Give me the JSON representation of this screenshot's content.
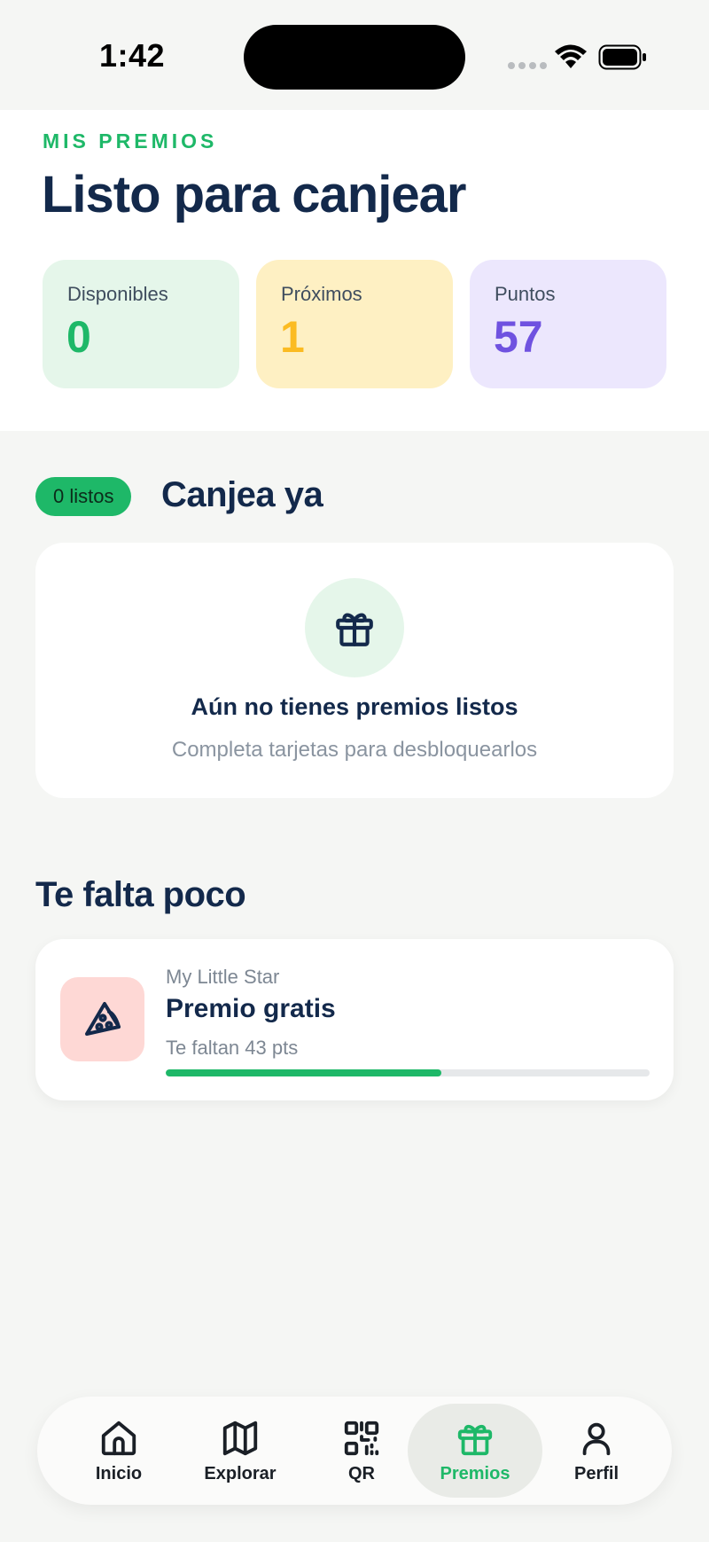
{
  "status_bar": {
    "time": "1:42"
  },
  "header": {
    "eyebrow": "MIS PREMIOS",
    "title": "Listo para canjear",
    "stats": [
      {
        "label": "Disponibles",
        "value": "0",
        "color": "#1eb868"
      },
      {
        "label": "Próximos",
        "value": "1",
        "color": "#fbbb22"
      },
      {
        "label": "Puntos",
        "value": "57",
        "color": "#6f52e0"
      }
    ]
  },
  "ready_section": {
    "badge": "0 listos",
    "title": "Canjea ya",
    "empty_icon": "gift-icon",
    "empty_title": "Aún no tienes premios listos",
    "empty_subtitle": "Completa tarjetas para desbloquearlos"
  },
  "near_section": {
    "title": "Te falta poco",
    "rewards": [
      {
        "icon": "pizza-icon",
        "store": "My Little Star",
        "name": "Premio gratis",
        "missing": "Te faltan 43 pts",
        "progress": 0.57
      }
    ]
  },
  "tab_bar": {
    "items": [
      {
        "label": "Inicio",
        "icon": "home-icon"
      },
      {
        "label": "Explorar",
        "icon": "map-icon"
      },
      {
        "label": "QR",
        "icon": "qr-icon"
      },
      {
        "label": "Premios",
        "icon": "gift-icon",
        "active": true
      },
      {
        "label": "Perfil",
        "icon": "user-icon"
      }
    ]
  },
  "colors": {
    "accent": "#1eb868",
    "text": "#13294b"
  }
}
